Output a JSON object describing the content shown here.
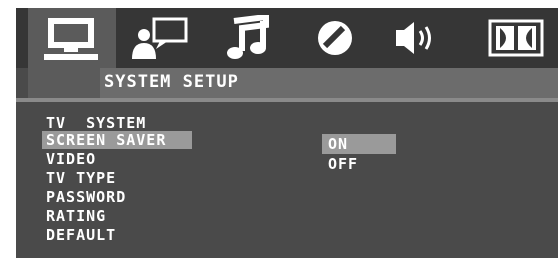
{
  "header": {
    "tabs": [
      {
        "id": "system",
        "icon": "monitor-icon",
        "selected": true
      },
      {
        "id": "language",
        "icon": "person-speech-icon",
        "selected": false
      },
      {
        "id": "audio",
        "icon": "music-note-icon",
        "selected": false
      },
      {
        "id": "video",
        "icon": "circle-slash-icon",
        "selected": false
      },
      {
        "id": "speaker",
        "icon": "speaker-icon",
        "selected": false
      },
      {
        "id": "dolby",
        "icon": "dolby-logo-icon",
        "selected": false
      }
    ],
    "title": "SYSTEM SETUP"
  },
  "menu": {
    "items": [
      "TV  SYSTEM",
      "SCREEN SAVER",
      "VIDEO",
      "TV TYPE",
      "PASSWORD",
      "RATING",
      "DEFAULT"
    ],
    "selected_index": 1
  },
  "options": {
    "items": [
      "ON",
      "OFF"
    ],
    "selected_index": 0
  },
  "colors": {
    "icon_bar": "#363636",
    "selected_tab": "#5b5b5b",
    "title_band": "#6c6c6c",
    "panel": "#4a4a4a",
    "highlight": "#9a9a9a",
    "text": "#ffffff"
  }
}
